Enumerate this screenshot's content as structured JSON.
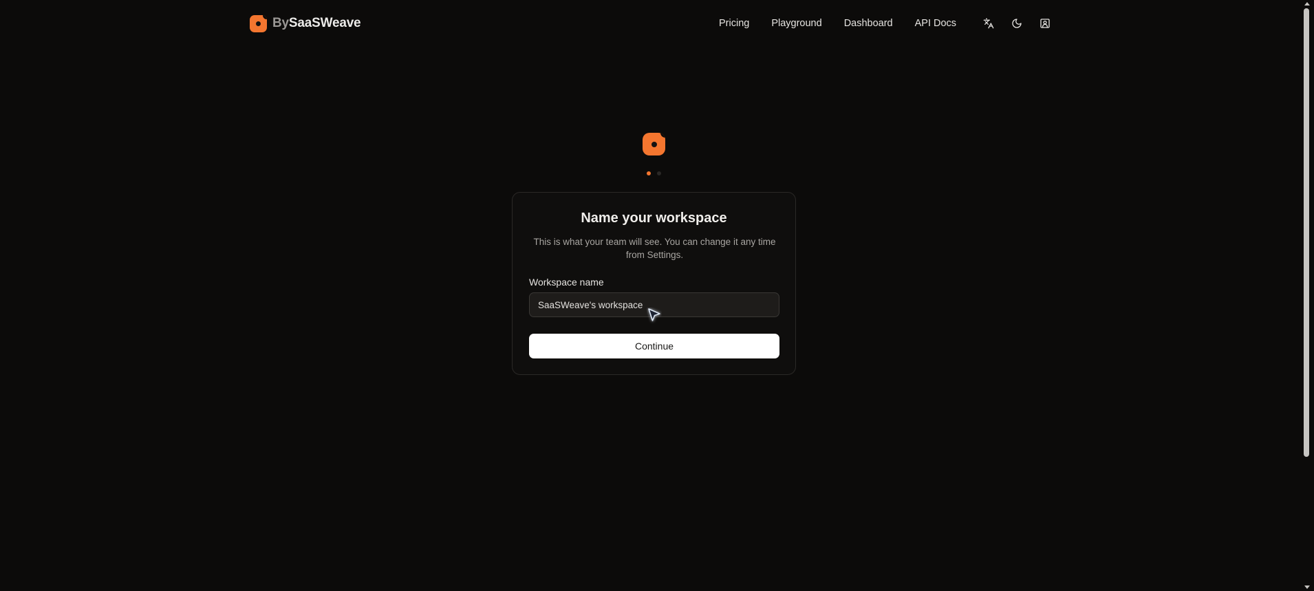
{
  "brand": {
    "prefix": "By",
    "name": "SaaSWeave"
  },
  "nav": {
    "links": [
      "Pricing",
      "Playground",
      "Dashboard",
      "API Docs"
    ],
    "icons": [
      "translate-icon",
      "moon-icon",
      "user-square-icon"
    ]
  },
  "onboarding": {
    "steps_total": 2,
    "current_step": 1,
    "title": "Name your workspace",
    "subtitle": "This is what your team will see. You can change it any time from Settings.",
    "field_label": "Workspace name",
    "field_value": "SaaSWeave's workspace",
    "continue_label": "Continue"
  },
  "colors": {
    "accent": "#f4762f",
    "background": "#0c0b0a",
    "button": "#ffffff"
  }
}
